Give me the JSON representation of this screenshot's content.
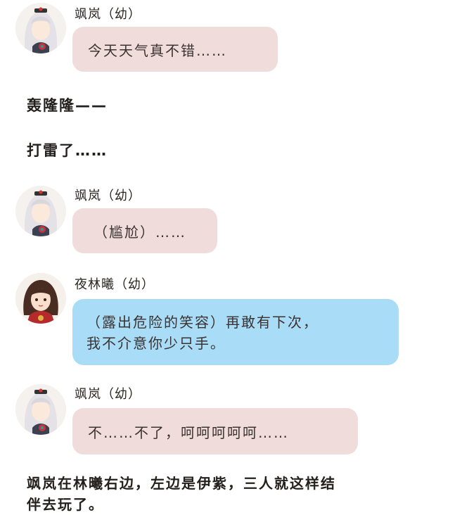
{
  "messages": [
    {
      "speaker": "飒岚（幼）",
      "text": "今天天气真不错……",
      "avatar": "white-hair-avatar"
    },
    {
      "speaker": "飒岚（幼）",
      "text": "（尴尬）……",
      "avatar": "white-hair-avatar"
    },
    {
      "speaker": "夜林曦（幼）",
      "text_line1": "（露出危险的笑容）再敢有下次，",
      "text_line2": "我不介意你少只手。",
      "avatar": "brown-hair-avatar"
    },
    {
      "speaker": "飒岚（幼）",
      "text": "不……不了，呵呵呵呵呵……",
      "avatar": "white-hair-avatar"
    }
  ],
  "narration": {
    "thunder": "轰隆隆——",
    "lightning": "打雷了……",
    "ending_line1": "飒岚在林曦右边，左边是伊紫，三人就这样结",
    "ending_line2": "伴去玩了。"
  },
  "colors": {
    "pink_bubble": "#f1dcdc",
    "blue_bubble": "#a9dcf7"
  }
}
